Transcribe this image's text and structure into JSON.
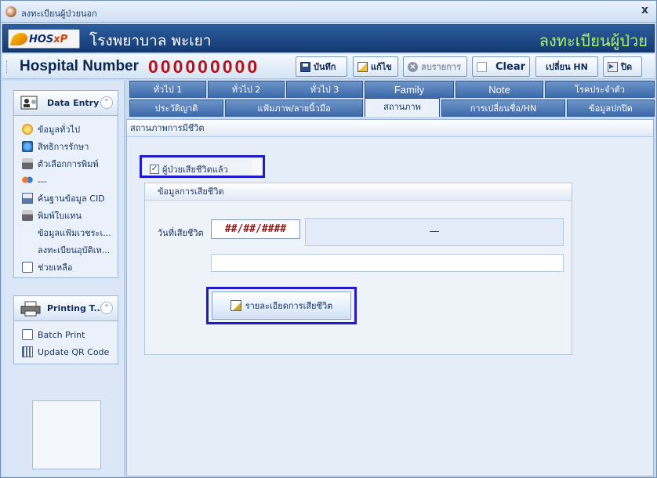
{
  "window": {
    "title": "ลงทะเบียนผู้ป่วยนอก",
    "close_label": "x"
  },
  "banner": {
    "logo_text": "HOS",
    "logo_suffix": "xP",
    "hospital_name": "โรงพยาบาล พะเยา",
    "form_name": "ลงทะเบียนผู้ป่วย"
  },
  "toolbar": {
    "hn_label": "Hospital Number",
    "hn_value": "000000000",
    "buttons": {
      "save": "บันทึก",
      "edit": "แก้ไข",
      "delete": "ลบรายการ",
      "clear": "Clear",
      "change_hn": "เปลี่ยน HN",
      "close": "ปิด"
    }
  },
  "sidebar": {
    "data_entry": {
      "title": "Data Entry",
      "items": [
        {
          "label": "ข้อมูลทั่วไป",
          "icon": "info-icon"
        },
        {
          "label": "สิทธิการรักษา",
          "icon": "globe-icon"
        },
        {
          "label": "ตัวเลือกการพิมพ์",
          "icon": "printer-icon"
        },
        {
          "label": "---",
          "icon": "people-icon"
        },
        {
          "label": "ค้นฐานข้อมูล CID",
          "icon": "scanner-icon"
        },
        {
          "label": "พิมพ์ใบแทน",
          "icon": "printer-icon"
        },
        {
          "label": "ข้อมูลแฟ้มเวชระเ...",
          "icon": ""
        },
        {
          "label": "ลงทะเบียนอุบัติเห...",
          "icon": ""
        },
        {
          "label": "ช่วยเหลือ",
          "icon": "card-icon"
        }
      ]
    },
    "printing": {
      "title": "Printing T...",
      "items": [
        {
          "label": "Batch Print",
          "icon": "card-icon"
        },
        {
          "label": "Update QR Code",
          "icon": "qr-icon"
        }
      ]
    }
  },
  "tabs": {
    "row1": [
      "ทั่วไป 1",
      "ทั่วไป 2",
      "ทั่วไป 3",
      "Family",
      "Note",
      "โรคประจำตัว"
    ],
    "row2": [
      "ประวัติญาติ",
      "แฟ้มภาพ/ลายนิ้วมือ",
      "สถานภาพ",
      "การเปลี่ยนชื่อ/HN",
      "ข้อมูลปกปิด"
    ],
    "active": "สถานภาพ"
  },
  "status": {
    "section_title": "สถานภาพการมีชีวิต",
    "deceased_checkbox_label": "ผู้ป่วยเสียชีวิตแล้ว",
    "deceased_checked": true,
    "death_info_title": "ข้อมูลการเสียชีวิต",
    "death_date_label": "วันที่เสียชีวิต",
    "death_date_value": "##/##/####",
    "dash_value": "—",
    "death_detail_button": "รายละเอียดการเสียชีวิต"
  },
  "colors": {
    "banner_bg": "#1d4a88",
    "hospital_name": "#ffffff",
    "form_name": "#a7f06b",
    "hn_value": "#b3141b",
    "highlight_border": "#1f1bcc"
  }
}
